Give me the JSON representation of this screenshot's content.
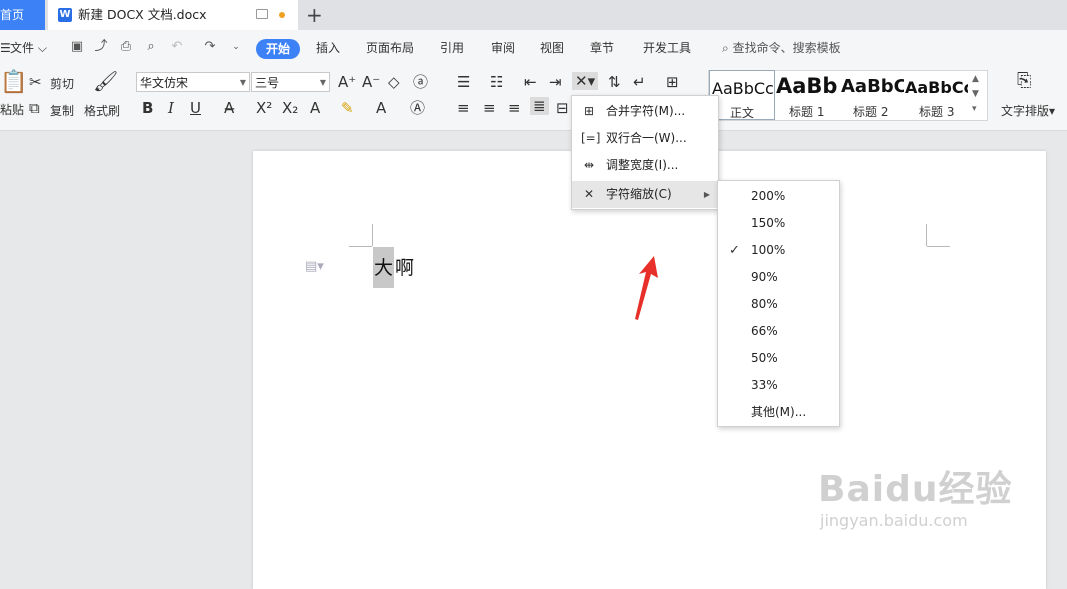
{
  "tabs": {
    "home": "首页",
    "document_title": "新建 DOCX 文档.docx",
    "doc_icon_letter": "W",
    "new_tab": "+"
  },
  "menubar": {
    "file": "文件",
    "items": [
      "开始",
      "插入",
      "页面布局",
      "引用",
      "审阅",
      "视图",
      "章节",
      "开发工具"
    ],
    "search_placeholder": "查找命令、搜索模板"
  },
  "ribbon": {
    "clipboard": {
      "paste": "粘贴",
      "cut": "剪切",
      "copy": "复制",
      "format_painter": "格式刷"
    },
    "font": {
      "family": "华文仿宋",
      "size": "三号"
    },
    "styles": [
      {
        "sample": "AaBbCc",
        "label": "正文"
      },
      {
        "sample": "AaBb",
        "label": "标题 1"
      },
      {
        "sample": "AaBbC",
        "label": "标题 2"
      },
      {
        "sample": "AaBbCc",
        "label": "标题 3"
      }
    ],
    "text_layout": "文字排版"
  },
  "document": {
    "text_chars": [
      "大",
      "啊"
    ]
  },
  "context_menu": {
    "items": [
      {
        "label": "合并字符(M)...",
        "icon": "merge-chars-icon"
      },
      {
        "label": "双行合一(W)...",
        "icon": "two-lines-in-one-icon"
      },
      {
        "label": "调整宽度(I)...",
        "icon": "adjust-width-icon"
      },
      {
        "label": "字符缩放(C)",
        "icon": "char-scale-icon",
        "has_submenu": true,
        "active": true
      }
    ]
  },
  "scale_submenu": {
    "items": [
      "200%",
      "150%",
      "100%",
      "90%",
      "80%",
      "66%",
      "50%",
      "33%",
      "其他(M)..."
    ],
    "checked": "100%"
  },
  "watermark": {
    "brand": "Baidu经验",
    "url": "jingyan.baidu.com"
  },
  "colors": {
    "accent": "#3c82f6",
    "arrow": "#e8302a"
  }
}
